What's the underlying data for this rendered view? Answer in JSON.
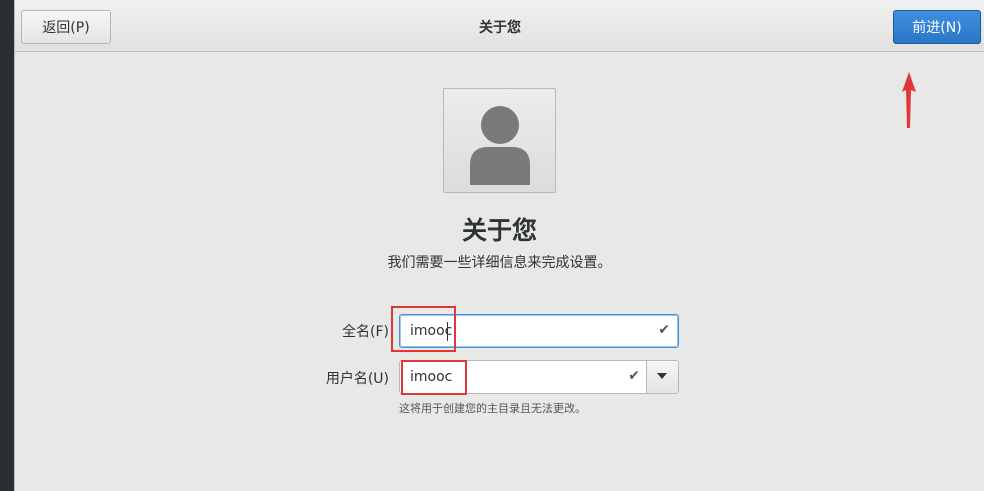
{
  "header": {
    "back_label": "返回(P)",
    "title": "关于您",
    "next_label": "前进(N)"
  },
  "main": {
    "heading": "关于您",
    "subtitle": "我们需要一些详细信息来完成设置。",
    "avatar_icon": "user-avatar-icon"
  },
  "form": {
    "full_name_label": "全名(F)",
    "full_name_value": "imooc",
    "username_label": "用户名(U)",
    "username_value": "imooc",
    "username_hint": "这将用于创建您的主目录且无法更改。",
    "check_glyph": "✔"
  },
  "colors": {
    "accent": "#2a76c6",
    "annotation": "#e03838"
  }
}
